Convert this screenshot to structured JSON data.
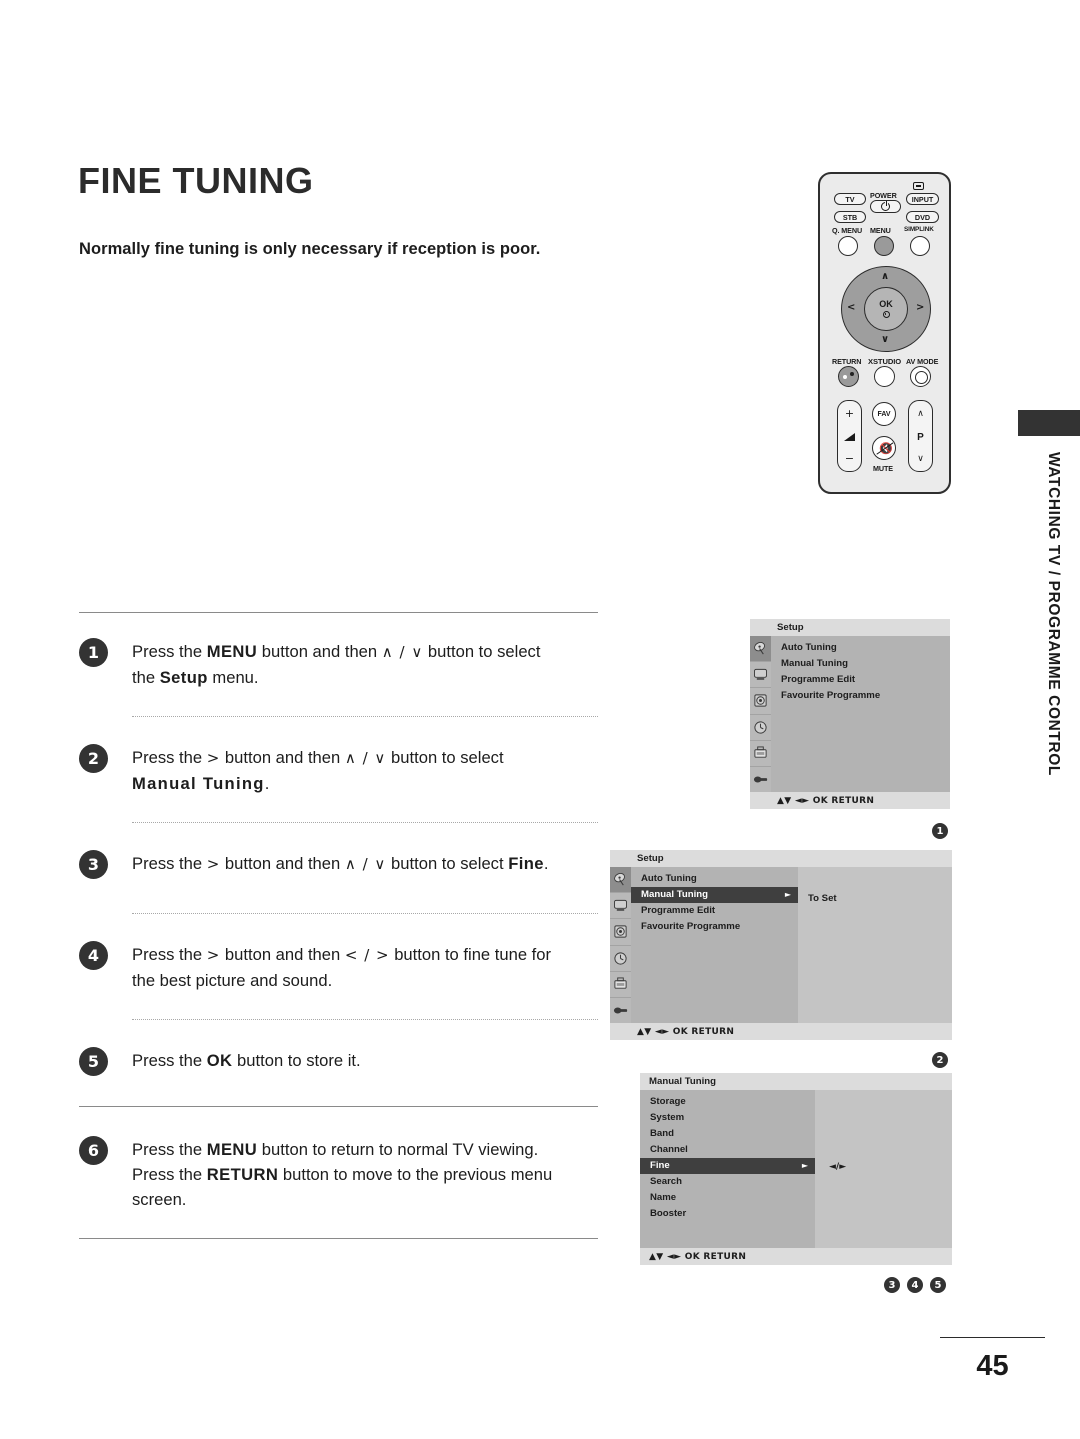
{
  "page": {
    "title": "FINE TUNING",
    "intro": "Normally fine tuning is only necessary if reception is poor.",
    "number": "45",
    "side_tab": "WATCHING TV / PROGRAMME CONTROL"
  },
  "steps": [
    {
      "num": "1",
      "line1_a": "Press the ",
      "line1_kb": "MENU",
      "line1_b": " button and then ",
      "line1_arrows": "∧ / ∨",
      "line1_c": " button to select",
      "line2_a": "the ",
      "line2_kb": "Setup",
      "line2_b": " menu."
    },
    {
      "num": "2",
      "line1_a": "Press the ",
      "line1_kb": ">",
      "line1_b": " button and then ",
      "line1_arrows": "∧ / ∨",
      "line1_c": " button to select",
      "line2_kb": "Manual Tuning",
      "line2_b": "."
    },
    {
      "num": "3",
      "line1_a": "Press the ",
      "line1_kb": ">",
      "line1_b": " button and then ",
      "line1_arrows": "∧ / ∨",
      "line1_c": " button to select ",
      "line1_kb2": "Fine",
      "line1_d": "."
    },
    {
      "num": "4",
      "line1_a": "Press the ",
      "line1_kb": ">",
      "line1_b": " button and then ",
      "line1_arrows": "< / >",
      "line1_c": " button to fine tune for",
      "line2_b": "the best picture and sound."
    },
    {
      "num": "5",
      "line1_a": "Press the ",
      "line1_kb": "OK",
      "line1_b": " button to store it."
    },
    {
      "num": "6",
      "line1_a": "Press the ",
      "line1_kb": "MENU",
      "line1_b": " button to return to normal TV viewing.",
      "line2_a": "Press the ",
      "line2_kb": "RETURN",
      "line2_b": " button to move to the previous menu screen."
    }
  ],
  "remote": {
    "tv": "TV",
    "power": "POWER",
    "input": "INPUT",
    "stb": "STB",
    "dvd": "DVD",
    "q_menu": "Q. MENU",
    "menu": "MENU",
    "simplink": "SIMPLINK",
    "ok": "OK",
    "return": "RETURN",
    "xstudio": "XSTUDIO",
    "av_mode": "AV MODE",
    "fav": "FAV",
    "mute": "MUTE",
    "prog": "P",
    "vol_plus": "+",
    "vol_minus": "−",
    "arrow_up": "∧",
    "arrow_down": "∨",
    "arrow_left": "<",
    "arrow_right": ">"
  },
  "osd1": {
    "title": "Setup",
    "items": [
      {
        "label": "Auto Tuning",
        "selected": false
      },
      {
        "label": "Manual Tuning",
        "selected": false
      },
      {
        "label": "Programme Edit",
        "selected": false
      },
      {
        "label": "Favourite Programme",
        "selected": false
      }
    ],
    "footer": "▲▼  ◄►  OK  RETURN",
    "marker": "1"
  },
  "osd2": {
    "title": "Setup",
    "items": [
      {
        "label": "Auto Tuning",
        "selected": false
      },
      {
        "label": "Manual Tuning",
        "selected": true,
        "caret": "►"
      },
      {
        "label": "Programme Edit",
        "selected": false
      },
      {
        "label": "Favourite Programme",
        "selected": false
      }
    ],
    "right_label": "To Set",
    "footer": "▲▼  ◄►  OK  RETURN",
    "marker": "2"
  },
  "osd3": {
    "title": "Manual Tuning",
    "items": [
      {
        "label": "Storage",
        "selected": false
      },
      {
        "label": "System",
        "selected": false
      },
      {
        "label": "Band",
        "selected": false
      },
      {
        "label": "Channel",
        "selected": false
      },
      {
        "label": "Fine",
        "selected": true,
        "caret": "►"
      },
      {
        "label": "Search",
        "selected": false
      },
      {
        "label": "Name",
        "selected": false
      },
      {
        "label": "Booster",
        "selected": false
      }
    ],
    "right_label": "◄/►",
    "footer": "▲▼  ◄►  OK  RETURN",
    "markers": [
      "3",
      "4",
      "5"
    ]
  },
  "colors": {
    "dark": "#333333",
    "menu_bg": "#b3b3b3",
    "menu_chrome": "#dcdcdc",
    "highlight": "#3f3f3f"
  }
}
